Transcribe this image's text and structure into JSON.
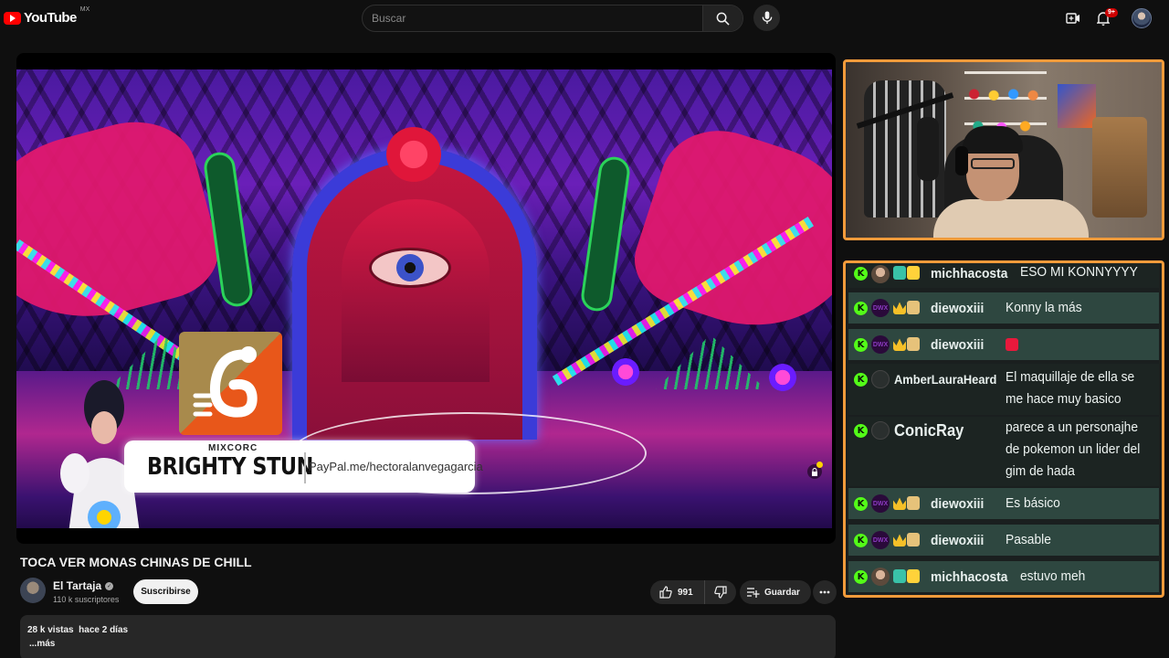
{
  "app": {
    "logo_text": "YouTube",
    "region": "MX"
  },
  "search": {
    "placeholder": "Buscar"
  },
  "header": {
    "notification_count": "9+"
  },
  "video": {
    "title": "TOCA VER MONAS CHINAS DE CHILL",
    "overlay": {
      "small_label": "MIXCORC",
      "performer_name": "BRIGHTY STUN",
      "paypal_text": "PayPal.me/hectoralanvegagarcia"
    }
  },
  "channel": {
    "name": "El Tartaja",
    "subscribers": "110 k suscriptores",
    "subscribe_label": "Suscribirse"
  },
  "actions": {
    "likes": "991",
    "save_label": "Guardar"
  },
  "description": {
    "stats": "28 k vistas  hace 2 días",
    "more_label": "...más"
  },
  "chat": {
    "messages": [
      {
        "user": "michhacosta",
        "text": "ESO MI KONNYYYY"
      },
      {
        "user": "diewoxiii",
        "text": "Konny la más"
      },
      {
        "user": "diewoxiii",
        "text": ""
      },
      {
        "user": "AmberLauraHeard",
        "text": "El maquillaje de ella se me hace muy basico"
      },
      {
        "user": "ConicRay",
        "text": "parece a un personajhe de pokemon un lider del gim de hada"
      },
      {
        "user": "diewoxiii",
        "text": "Es básico"
      },
      {
        "user": "diewoxiii",
        "text": "Pasable"
      },
      {
        "user": "michhacosta",
        "text": "estuvo meh"
      }
    ],
    "message_lines": {
      "amber": [
        "El maquillaje de ella se",
        "me hace muy basico"
      ],
      "conic": [
        "parece a un personajhe",
        "de pokemon un lider del",
        "gim de hada"
      ]
    }
  },
  "colors": {
    "accent_border": "#f29b3b",
    "kick_green": "#53fc18",
    "youtube_red": "#ff0000"
  }
}
